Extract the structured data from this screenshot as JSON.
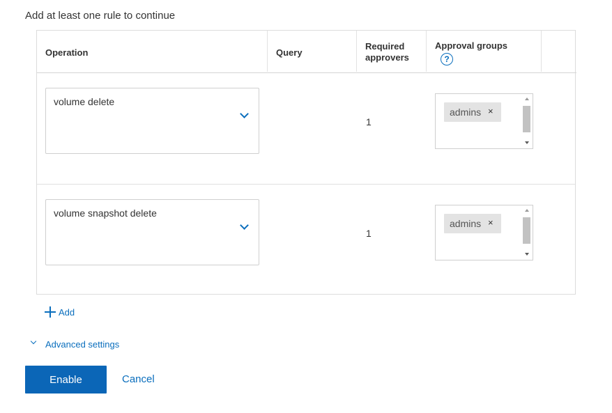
{
  "heading": "Add at least one rule to continue",
  "table": {
    "columns": {
      "operation": "Operation",
      "query": "Query",
      "required_approvers_line1": "Required",
      "required_approvers_line2": "approvers",
      "approval_groups": "Approval groups",
      "help_icon": "?"
    },
    "rows": [
      {
        "operation": "volume delete",
        "query": "",
        "required_approvers": "1",
        "groups": [
          "admins"
        ]
      },
      {
        "operation": "volume snapshot delete",
        "query": "",
        "required_approvers": "1",
        "groups": [
          "admins"
        ]
      }
    ],
    "chip_remove_glyph": "×"
  },
  "add_label": "Add",
  "advanced_settings_label": "Advanced settings",
  "buttons": {
    "enable": "Enable",
    "cancel": "Cancel"
  },
  "icons": {
    "plus": "plus-icon",
    "help": "help-circle-icon",
    "chevron": "chevron-down-icon",
    "remove": "close-icon"
  },
  "colors": {
    "accent": "#0a6ebd",
    "primary_button": "#0b66b7",
    "chip": "#e3e3e3",
    "border": "#d4d4d4"
  }
}
